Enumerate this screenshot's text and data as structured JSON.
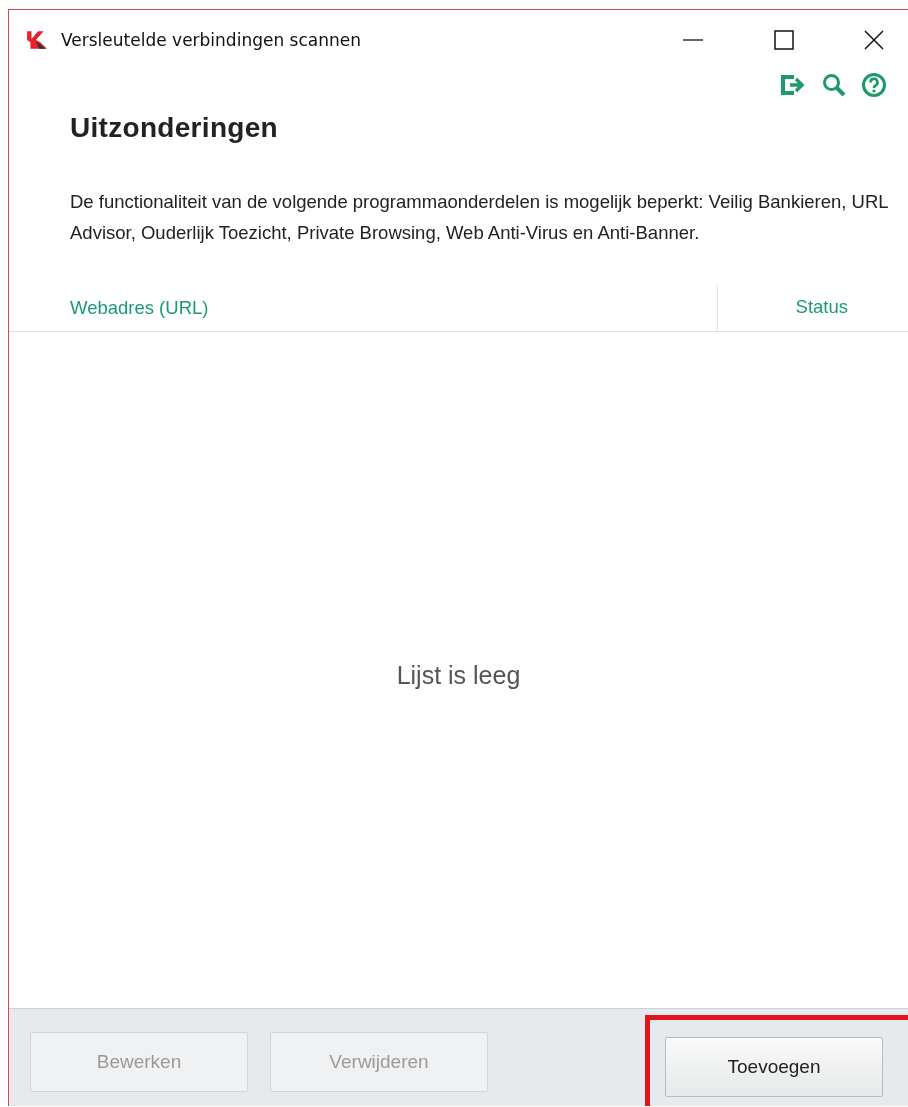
{
  "window": {
    "title": "Versleutelde verbindingen scannen"
  },
  "heading": "Uitzonderingen",
  "description": "De functionaliteit van de volgende programmaonderdelen is mogelijk beperkt: Veilig Bankieren, URL Advisor, Ouderlijk Toezicht, Private Browsing, Web Anti-Virus en Anti-Banner.",
  "table": {
    "columns": [
      "Webadres (URL)",
      "Status"
    ],
    "empty_text": "Lijst is leeg"
  },
  "buttons": [
    {
      "label": "Bewerken",
      "disabled": true,
      "highlighted": false
    },
    {
      "label": "Verwijderen",
      "disabled": true,
      "highlighted": false
    },
    {
      "label": "Toevoegen",
      "disabled": false,
      "highlighted": true
    }
  ]
}
